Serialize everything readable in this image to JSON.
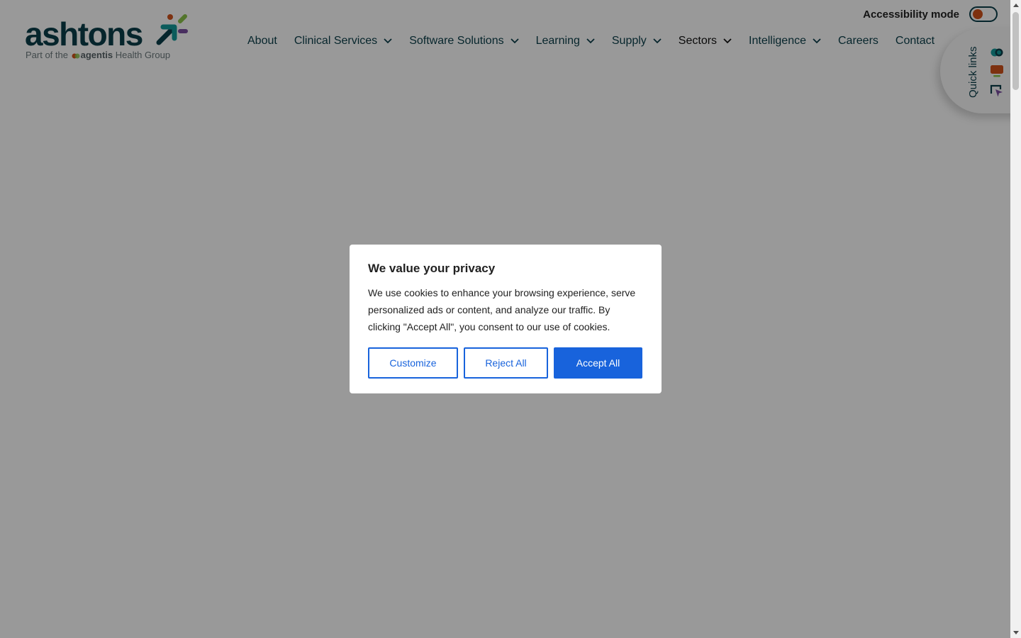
{
  "brand": {
    "name": "ashtons",
    "tagline_prefix": "Part of the",
    "tagline_brand": "agentis",
    "tagline_suffix": "Health Group",
    "colors": {
      "primary": "#0b3f4a",
      "orange": "#d0521c",
      "green": "#8bc34a",
      "purple": "#7b4fa0",
      "teal": "#139a9a"
    }
  },
  "accessibility": {
    "label": "Accessibility mode",
    "enabled": false
  },
  "nav": {
    "items": [
      {
        "label": "About",
        "has_dropdown": false
      },
      {
        "label": "Clinical Services",
        "has_dropdown": true
      },
      {
        "label": "Software Solutions",
        "has_dropdown": true
      },
      {
        "label": "Learning",
        "has_dropdown": true
      },
      {
        "label": "Supply",
        "has_dropdown": true
      },
      {
        "label": "Sectors",
        "has_dropdown": true
      },
      {
        "label": "Intelligence",
        "has_dropdown": true
      },
      {
        "label": "Careers",
        "has_dropdown": false
      },
      {
        "label": "Contact",
        "has_dropdown": false
      }
    ]
  },
  "quick_links": {
    "label": "Quick links",
    "icons": [
      "toggle-icon",
      "chat-icon",
      "cursor-icon"
    ]
  },
  "cookie_modal": {
    "title": "We value your privacy",
    "text": "We use cookies to enhance your browsing experience, serve personalized ads or content, and analyze our traffic. By clicking \"Accept All\", you consent to our use of cookies.",
    "buttons": {
      "customize": "Customize",
      "reject": "Reject All",
      "accept": "Accept All"
    },
    "accent_color": "#1863dc"
  }
}
